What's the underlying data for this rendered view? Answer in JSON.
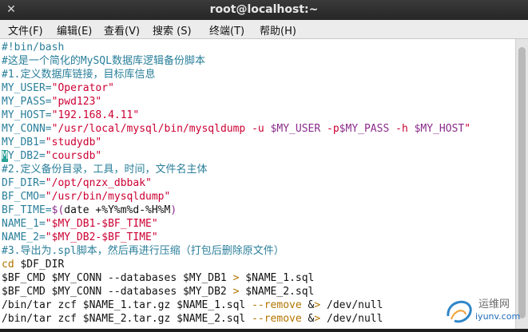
{
  "window": {
    "title": "root@localhost:~"
  },
  "menu": [
    {
      "label": "文件(F)"
    },
    {
      "label": "编辑(E)"
    },
    {
      "label": "查看(V)"
    },
    {
      "label": "搜索 (S)"
    },
    {
      "label": "终端(T)"
    },
    {
      "label": "帮助(H)"
    }
  ],
  "lines": [
    {
      "segments": [
        {
          "text": "#!bin/bash",
          "cls": "c"
        }
      ]
    },
    {
      "segments": [
        {
          "text": "#这是一个简化的MySQL数据库逻辑备份脚本",
          "cls": "c"
        }
      ]
    },
    {
      "segments": [
        {
          "text": "#1.定义数据库链接，目标库信息",
          "cls": "c"
        }
      ]
    },
    {
      "segments": [
        {
          "text": "MY_USER=",
          "cls": "t"
        },
        {
          "text": "\"Operator\"",
          "cls": "r"
        }
      ]
    },
    {
      "segments": [
        {
          "text": "MY_PASS=",
          "cls": "t"
        },
        {
          "text": "\"pwd123\"",
          "cls": "r"
        }
      ]
    },
    {
      "segments": [
        {
          "text": "MY_HOST=",
          "cls": "t"
        },
        {
          "text": "\"192.168.4.11\"",
          "cls": "r"
        }
      ]
    },
    {
      "segments": [
        {
          "text": "MY_CONN=",
          "cls": "t"
        },
        {
          "text": "\"/usr/local/mysql/bin/mysqldump -u ",
          "cls": "r"
        },
        {
          "text": "$MY_USER",
          "cls": "v"
        },
        {
          "text": " -p",
          "cls": "r"
        },
        {
          "text": "$MY_PASS",
          "cls": "v"
        },
        {
          "text": " -h ",
          "cls": "r"
        },
        {
          "text": "$MY_HOST",
          "cls": "v"
        },
        {
          "text": "\"",
          "cls": "r"
        }
      ]
    },
    {
      "segments": [
        {
          "text": "MY_DB1=",
          "cls": "t"
        },
        {
          "text": "\"studydb\"",
          "cls": "r"
        }
      ]
    },
    {
      "segments": [
        {
          "text": "M",
          "cls": "cursor"
        },
        {
          "text": "Y_DB2=",
          "cls": "t"
        },
        {
          "text": "\"coursdb\"",
          "cls": "r"
        }
      ]
    },
    {
      "segments": [
        {
          "text": "#2.定义备份目录，工具，时间，文件名主体",
          "cls": "c"
        }
      ]
    },
    {
      "segments": [
        {
          "text": "DF_DIR=",
          "cls": "t"
        },
        {
          "text": "\"/opt/qnzx_dbbak\"",
          "cls": "r"
        }
      ]
    },
    {
      "segments": [
        {
          "text": "BF_CMO=",
          "cls": "t"
        },
        {
          "text": "\"/usr/bin/mysqldump\"",
          "cls": "r"
        }
      ]
    },
    {
      "segments": [
        {
          "text": "BF_TIME=",
          "cls": "t"
        },
        {
          "text": "$(",
          "cls": "v"
        },
        {
          "text": "date +%Y%m%d-%H%M",
          "cls": "n"
        },
        {
          "text": ")",
          "cls": "v"
        }
      ]
    },
    {
      "segments": [
        {
          "text": "NAME_1=",
          "cls": "t"
        },
        {
          "text": "\"$MY_DB1-$BF_TIME\"",
          "cls": "r"
        }
      ]
    },
    {
      "segments": [
        {
          "text": "NAME_2=",
          "cls": "t"
        },
        {
          "text": "\"$MY_DB2-$BF_TIME\"",
          "cls": "r"
        }
      ]
    },
    {
      "segments": [
        {
          "text": "#3.导出为.spl脚本，然后再进行压缩（打包后删除原文件）",
          "cls": "c"
        }
      ]
    },
    {
      "segments": [
        {
          "text": "cd",
          "cls": "k"
        },
        {
          "text": " $DF_DIR",
          "cls": "n"
        }
      ]
    },
    {
      "segments": [
        {
          "text": "$BF_CMD $MY_CONN --databases $MY_DB1 ",
          "cls": "n"
        },
        {
          "text": ">",
          "cls": "k"
        },
        {
          "text": " $NAME_1.sql",
          "cls": "n"
        }
      ]
    },
    {
      "segments": [
        {
          "text": "$BF_CMD $MY_CONN --databases $MY_DB2 ",
          "cls": "n"
        },
        {
          "text": ">",
          "cls": "k"
        },
        {
          "text": " $NAME_2.sql",
          "cls": "n"
        }
      ]
    },
    {
      "segments": [
        {
          "text": "/bin/tar zcf $NAME_1.tar.gz $NAME_1.sql ",
          "cls": "n"
        },
        {
          "text": "--remove",
          "cls": "k"
        },
        {
          "text": " &",
          "cls": "n"
        },
        {
          "text": ">",
          "cls": "k"
        },
        {
          "text": " /dev/null",
          "cls": "n"
        }
      ]
    },
    {
      "segments": [
        {
          "text": "/bin/tar zcf $NAME_2.tar.gz $NAME_2.sql ",
          "cls": "n"
        },
        {
          "text": "--remove",
          "cls": "k"
        },
        {
          "text": " &",
          "cls": "n"
        },
        {
          "text": ">",
          "cls": "k"
        },
        {
          "text": " /dev/null",
          "cls": "n"
        }
      ]
    }
  ],
  "watermark": {
    "line1": "运维网",
    "line2": "iyunv.com"
  }
}
